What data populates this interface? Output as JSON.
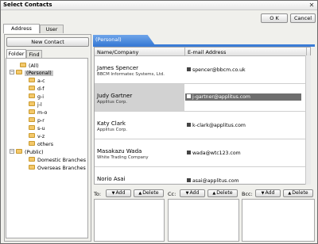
{
  "window": {
    "title": "Select Contacts",
    "ok_label": "O K",
    "cancel_label": "Cancel"
  },
  "tabs": [
    "Address Book",
    "User List"
  ],
  "new_contact_label": "New Contact",
  "left_tabs": [
    "Folder",
    "Find"
  ],
  "tree": {
    "all": "(All)",
    "personal": "(Personal)",
    "personal_children": [
      "a-c",
      "d-f",
      "g-i",
      "j-l",
      "m-o",
      "p-r",
      "s-u",
      "v-z",
      "others"
    ],
    "public": "(Public)",
    "public_children": [
      "Domestic Branches",
      "Overseas Branches"
    ]
  },
  "list": {
    "header_tab": "(Personal)",
    "col_name": "Name/Company",
    "col_email": "E-mail Address",
    "rows": [
      {
        "name": "James Spencer",
        "company": "BBCM Informatec Systems, Ltd.",
        "email": "spencer@bbcm.co.uk"
      },
      {
        "name": "Judy Gartner",
        "company": "Applitus Corp.",
        "email": "j-gartner@applitus.com"
      },
      {
        "name": "Katy Clark",
        "company": "Applitus Corp.",
        "email": "k-clark@applitus.com"
      },
      {
        "name": "Masakazu Wada",
        "company": "White Trading Company",
        "email": "wada@wtc123.com"
      },
      {
        "name": "Norio Asai",
        "company": "",
        "email": "asai@applitus.com"
      }
    ]
  },
  "recipients": {
    "to_label": "To:",
    "cc_label": "Cc:",
    "bcc_label": "Bcc:",
    "add_label": "Add",
    "delete_label": "Delete"
  }
}
